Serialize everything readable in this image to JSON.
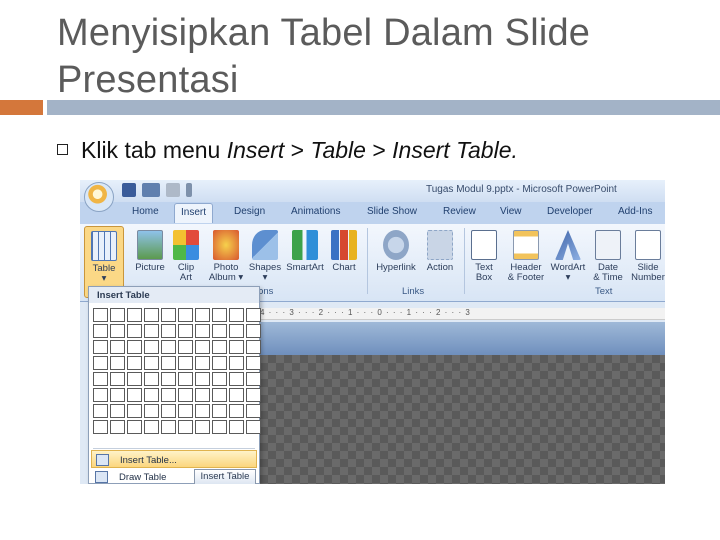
{
  "slide": {
    "title_line1": "Menyisipkan Tabel Dalam Slide",
    "title_line2": "Presentasi",
    "bullet": {
      "prefix": "Klik tab menu ",
      "insert": "Insert",
      "sep1": " > ",
      "table": "Table",
      "sep2": " > ",
      "insert_table": "Insert Table."
    }
  },
  "colors": {
    "accent_orange": "#d4773b",
    "accent_blue_grey": "#a3b3c7",
    "title_text": "#5b5b5b"
  },
  "screenshot": {
    "window_title": "Tugas Modul 9.pptx - Microsoft PowerPoint",
    "tabs": [
      "Home",
      "Insert",
      "Design",
      "Animations",
      "Slide Show",
      "Review",
      "View",
      "Developer",
      "Add-Ins"
    ],
    "active_tab": "Insert",
    "ribbon_buttons": {
      "table": "Table",
      "table_arrow": "▾",
      "picture": "Picture",
      "clip_art": "Clip\nArt",
      "photo_album": "Photo\nAlbum ▾",
      "shapes": "Shapes\n▾",
      "smartart": "SmartArt",
      "chart": "Chart",
      "hyperlink": "Hyperlink",
      "action": "Action",
      "text_box": "Text\nBox",
      "header_footer": "Header\n& Footer",
      "wordart": "WordArt\n▾",
      "date_time": "Date\n& Time",
      "slide_number": "Slide\nNumber"
    },
    "group_labels": {
      "illustrations": "ions",
      "links": "Links",
      "text": "Text"
    },
    "ruler": "4 · · · 3 · · · 2 · · · 1 · · · 0 · · · 1 · · · 2 · · · 3",
    "dropdown": {
      "header": "Insert Table",
      "insert_table": "Insert Table...",
      "draw_table": "Draw Table"
    },
    "tooltip": "Insert Table"
  }
}
